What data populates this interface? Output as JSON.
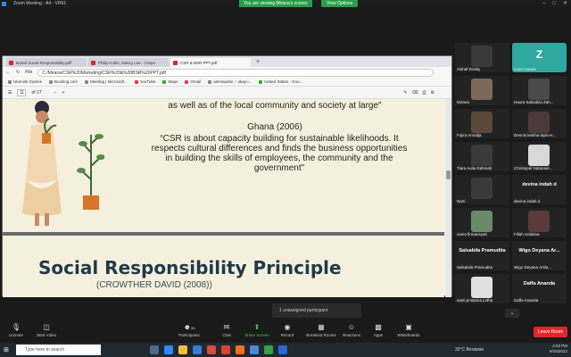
{
  "zoom": {
    "title": "Zoom Meeting - A4 - VR61",
    "viewing_banner": "You are viewing Mirana's screen",
    "view_options": "View Options"
  },
  "browser": {
    "tabs": [
      {
        "label": "Brand Social Responsibility.pdf",
        "active": false
      },
      {
        "label": "Philip Kotler, Nancy Lee - Corpo",
        "active": false
      },
      {
        "label": "CSR & BSR PPT.pdf",
        "active": true
      }
    ],
    "file_label": "File",
    "address": "C:/Mirana/CSR%20Marketing/CSR%20&%20BSR%20PPT.pdf",
    "bookmarks": [
      "Utomisk Games",
      "Booking.com",
      "Meeting | Microsoft...",
      "YouTube",
      "Maps",
      "Gmail",
      "animepahe :: okay-i...",
      "United States - Goo..."
    ],
    "page_current": "11",
    "page_total": "of 27"
  },
  "slide1": {
    "line_top": "as well as of  the  local community  and society at large\"",
    "author": "Ghana (2006)",
    "quote_lines": [
      "“CSR is about capacity building for sustainable likelihoods. It",
      "respects cultural differences and finds the business opportunities",
      "in building the skills of employees, the community and the",
      "government\""
    ]
  },
  "slide2": {
    "title": "Social Responsibility Principle",
    "subtitle": "(CROWTHER DAVID (2008))"
  },
  "participants": [
    {
      "name": "Aishaf Dzaky",
      "col": 0,
      "row": 0,
      "color": "#3a3a3a"
    },
    {
      "name": "zoom baaa4",
      "col": 1,
      "row": 0,
      "color": "#2ea8a0",
      "initial": "Z"
    },
    {
      "name": "Mirana",
      "col": 0,
      "row": 1,
      "color": "#7a6a5a"
    },
    {
      "name": "Haura Salsabila Zah...",
      "col": 1,
      "row": 1,
      "color": "#4a4a4a"
    },
    {
      "name": "Fojira Amodja",
      "col": 0,
      "row": 2,
      "color": "#5a4a3a"
    },
    {
      "name": "Dennis keisha layla H...",
      "col": 1,
      "row": 2,
      "color": "#4a3a3a"
    },
    {
      "name": "Tiara Aulia Rahmah",
      "col": 0,
      "row": 3,
      "color": "#3a3a3a"
    },
    {
      "name": "Christopel Natanael...",
      "col": 1,
      "row": 3,
      "color": "#d8d8d8"
    },
    {
      "name": "Narti",
      "col": 0,
      "row": 4,
      "color": "#3a3a3a"
    },
    {
      "name": "devina indah d",
      "col": 1,
      "row": 4,
      "color": "#232323",
      "big": "devina indah d"
    },
    {
      "name": "sania firmansyah",
      "col": 0,
      "row": 5,
      "color": "#6a8a6a"
    },
    {
      "name": "Fillah Halatina",
      "col": 1,
      "row": 5,
      "color": "#5a3a3a"
    },
    {
      "name": "Salsabila Pramudita",
      "col": 0,
      "row": 6,
      "color": "#232323",
      "big": "Salsabila Pramudita"
    },
    {
      "name": "Wigo Deyana Artila...",
      "col": 1,
      "row": 6,
      "color": "#232323",
      "big": "Wigo Deyana Ar..."
    },
    {
      "name": "santi pristama judha",
      "col": 0,
      "row": 7,
      "color": "#e0e0e0"
    },
    {
      "name": "Daffa Ananda",
      "col": 1,
      "row": 7,
      "color": "#232323",
      "big": "Daffa Ananda"
    }
  ],
  "toast": "1 unassigned participant",
  "controls": {
    "unmute": "Unmute",
    "start_video": "Start Video",
    "participants": "Participants",
    "participants_count": "33",
    "chat": "Chat",
    "share_screen": "Share Screen",
    "record": "Record",
    "breakout": "Breakout Rooms",
    "reactions": "Reactions",
    "apps": "Apps",
    "whiteboards": "Whiteboards",
    "leave": "Leave Room"
  },
  "taskbar": {
    "search": "Type here to search",
    "weather": "32°C  Berawan",
    "time": "2:03 PM",
    "date": "9/16/2022"
  }
}
